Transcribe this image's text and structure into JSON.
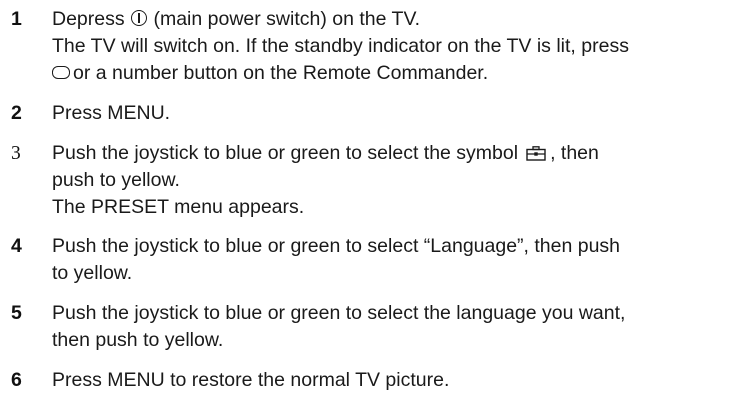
{
  "steps": [
    {
      "number": "1",
      "lines": [
        [
          "Depress ",
          "(main power switch) on the TV."
        ],
        [
          "The TV will switch on.  If the standby indicator on the TV is lit, press"
        ],
        [
          "or a number button on the Remote Commander."
        ]
      ],
      "icons": [
        "power-switch-icon",
        "standby-button-icon"
      ]
    },
    {
      "number": "2",
      "lines": [
        [
          "Press MENU."
        ]
      ]
    },
    {
      "number": "3",
      "lines": [
        [
          "Push the joystick to blue or green to select the symbol",
          ", then"
        ],
        [
          "push to yellow."
        ],
        [
          "The PRESET menu appears."
        ]
      ],
      "icons": [
        "preset-toolbox-icon"
      ]
    },
    {
      "number": "4",
      "lines": [
        [
          "Push the joystick to blue or green to select “Language”, then push"
        ],
        [
          "to yellow."
        ]
      ]
    },
    {
      "number": "5",
      "lines": [
        [
          "Push the joystick to blue or green to select the language you want,"
        ],
        [
          "then push to yellow."
        ]
      ]
    },
    {
      "number": "6",
      "lines": [
        [
          "Press MENU to restore the normal TV picture."
        ]
      ]
    }
  ]
}
